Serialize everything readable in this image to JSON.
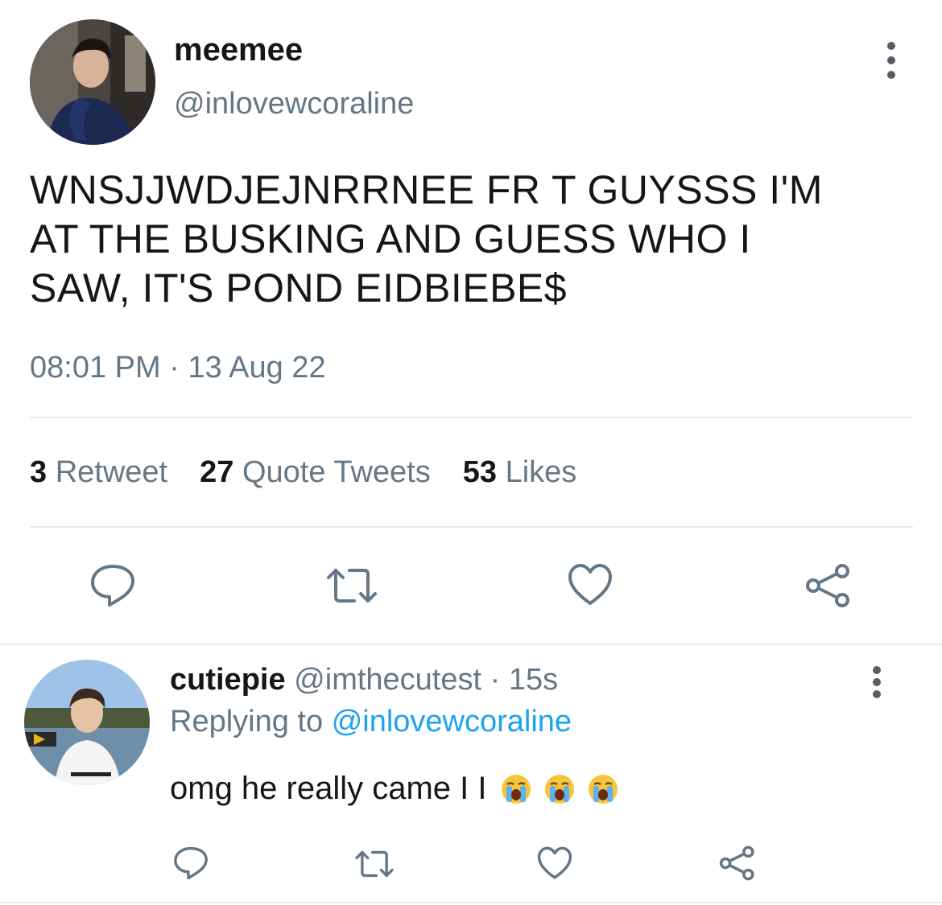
{
  "tweet": {
    "author_name": "meemee",
    "author_handle": "@inlovewcoraline",
    "text_lines": [
      "WNSJJWDJEJNRRNEE FR T GUYSSS I'M",
      "AT THE BUSKING AND GUESS WHO I",
      "SAW, IT'S POND EIDBIEBE$"
    ],
    "timestamp": "08:01 PM · 13 Aug 22",
    "stats": {
      "retweets_count": "3",
      "retweets_label": "Retweet",
      "quotes_count": "27",
      "quotes_label": "Quote Tweets",
      "likes_count": "53",
      "likes_label": "Likes"
    }
  },
  "reply": {
    "author_name": "cutiepie",
    "author_handle": "@imthecutest",
    "time_ago": "· 15s",
    "replying_prefix": "Replying to",
    "replying_handle": "@inlovewcoraline",
    "text": "omg he really came I I",
    "emojis": [
      "loudly-crying-face",
      "loudly-crying-face",
      "loudly-crying-face"
    ]
  },
  "icons": {
    "reply": "comment-icon",
    "retweet": "retweet-icon",
    "like": "heart-icon",
    "share": "share-icon",
    "more": "more-vertical-icon"
  },
  "colors": {
    "text_primary": "#14171a",
    "text_secondary": "#657786",
    "link": "#1da1f2",
    "divider": "#e6ecf0"
  }
}
